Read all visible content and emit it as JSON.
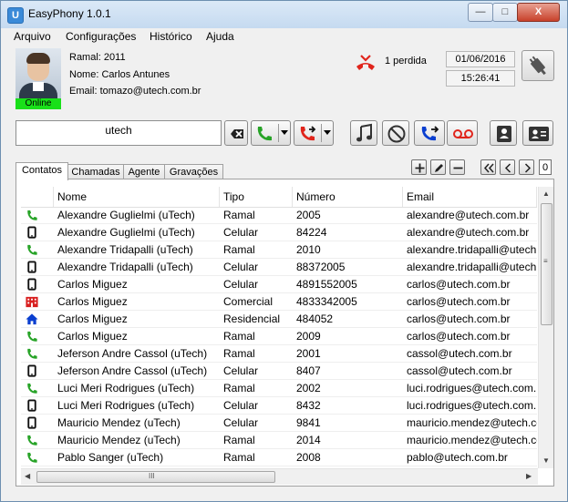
{
  "window": {
    "title": "EasyPhony 1.0.1",
    "app_icon_glyph": "U",
    "minimize": "—",
    "maximize": "□",
    "close": "X"
  },
  "menu": [
    "Arquivo",
    "Configurações",
    "Histórico",
    "Ajuda"
  ],
  "user": {
    "status": "Online",
    "ramal_label": "Ramal:",
    "ramal": "2011",
    "nome_label": "Nome:",
    "nome": "Carlos Antunes",
    "email_label": "Email:",
    "email": "tomazo@utech.com.br"
  },
  "status": {
    "missed": "1 perdida",
    "date": "01/06/2016",
    "time": "15:26:41"
  },
  "search": {
    "value": "utech"
  },
  "toolbar_icons": [
    "clear-icon",
    "call-icon",
    "transfer-icon",
    "music-icon",
    "block-icon",
    "forward-icon",
    "voicemail-icon",
    "contact-icon",
    "contact-card-icon"
  ],
  "tabs": [
    "Contatos",
    "Chamadas",
    "Agente",
    "Gravações"
  ],
  "pager": {
    "first": "≪",
    "prev": "<",
    "next": ">",
    "page": "0"
  },
  "columns": [
    "Nome",
    "Tipo",
    "Número",
    "Email"
  ],
  "colors": {
    "online": "#19e019",
    "phone_green": "#27a327",
    "red": "#e0241b",
    "blue": "#0a3fd0",
    "building_red": "#d81e1e"
  },
  "rows": [
    {
      "icon": "phone-icon",
      "nome": "Alexandre Guglielmi (uTech)",
      "tipo": "Ramal",
      "numero": "2005",
      "email": "alexandre@utech.com.br"
    },
    {
      "icon": "mobile-icon",
      "nome": "Alexandre Guglielmi (uTech)",
      "tipo": "Celular",
      "numero": "84224",
      "email": "alexandre@utech.com.br"
    },
    {
      "icon": "phone-icon",
      "nome": "Alexandre Tridapalli (uTech)",
      "tipo": "Ramal",
      "numero": "2010",
      "email": "alexandre.tridapalli@utech."
    },
    {
      "icon": "mobile-icon",
      "nome": "Alexandre Tridapalli (uTech)",
      "tipo": "Celular",
      "numero": "88372005",
      "email": "alexandre.tridapalli@utech."
    },
    {
      "icon": "mobile-icon",
      "nome": "Carlos Miguez",
      "tipo": "Celular",
      "numero": "4891552005",
      "email": "carlos@utech.com.br"
    },
    {
      "icon": "building-icon",
      "nome": "Carlos Miguez",
      "tipo": "Comercial",
      "numero": "4833342005",
      "email": "carlos@utech.com.br"
    },
    {
      "icon": "home-icon",
      "nome": "Carlos Miguez",
      "tipo": "Residencial",
      "numero": "484052",
      "email": "carlos@utech.com.br"
    },
    {
      "icon": "phone-icon",
      "nome": "Carlos Miguez",
      "tipo": "Ramal",
      "numero": "2009",
      "email": "carlos@utech.com.br"
    },
    {
      "icon": "phone-icon",
      "nome": "Jeferson Andre Cassol (uTech)",
      "tipo": "Ramal",
      "numero": "2001",
      "email": "cassol@utech.com.br"
    },
    {
      "icon": "mobile-icon",
      "nome": "Jeferson Andre Cassol (uTech)",
      "tipo": "Celular",
      "numero": "8407",
      "email": "cassol@utech.com.br"
    },
    {
      "icon": "phone-icon",
      "nome": "Luci Meri Rodrigues (uTech)",
      "tipo": "Ramal",
      "numero": "2002",
      "email": "luci.rodrigues@utech.com."
    },
    {
      "icon": "mobile-icon",
      "nome": "Luci Meri Rodrigues (uTech)",
      "tipo": "Celular",
      "numero": "8432",
      "email": "luci.rodrigues@utech.com."
    },
    {
      "icon": "mobile-icon",
      "nome": "Mauricio Mendez (uTech)",
      "tipo": "Celular",
      "numero": "9841",
      "email": "mauricio.mendez@utech.co"
    },
    {
      "icon": "phone-icon",
      "nome": "Mauricio Mendez (uTech)",
      "tipo": "Ramal",
      "numero": "2014",
      "email": "mauricio.mendez@utech.co"
    },
    {
      "icon": "phone-icon",
      "nome": "Pablo Sanger (uTech)",
      "tipo": "Ramal",
      "numero": "2008",
      "email": "pablo@utech.com.br"
    }
  ],
  "scroll": {
    "grip": "≡",
    "h_grip": "III"
  }
}
